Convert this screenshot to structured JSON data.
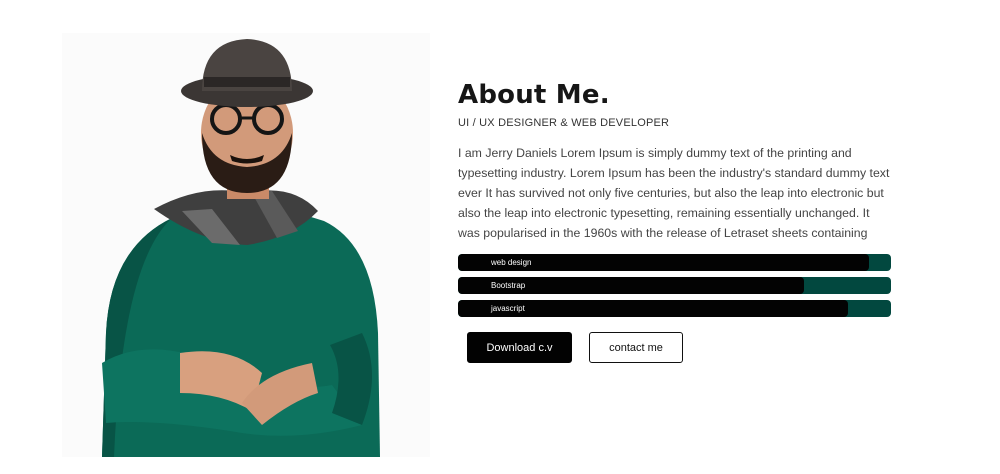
{
  "about": {
    "title": "About Me.",
    "subtitle": "UI / UX DESIGNER & WEB DEVELOPER",
    "bio": "I am Jerry Daniels Lorem Ipsum is simply dummy text of the printing and typesetting industry. Lorem Ipsum has been the industry's standard dummy text ever It has survived not only five centuries, but also the leap into electronic but also the leap into electronic typesetting, remaining essentially unchanged. It was popularised in the 1960s with the release of Letraset sheets containing"
  },
  "skills": [
    {
      "label": "web design",
      "percent": 95
    },
    {
      "label": "Bootstrap",
      "percent": 80
    },
    {
      "label": "javascript",
      "percent": 90
    }
  ],
  "buttons": {
    "download": "Download c.v",
    "contact": "contact me"
  },
  "colors": {
    "bar_track": "#02483f",
    "bar_fill": "#030303",
    "sweater": "#0b6a57"
  }
}
